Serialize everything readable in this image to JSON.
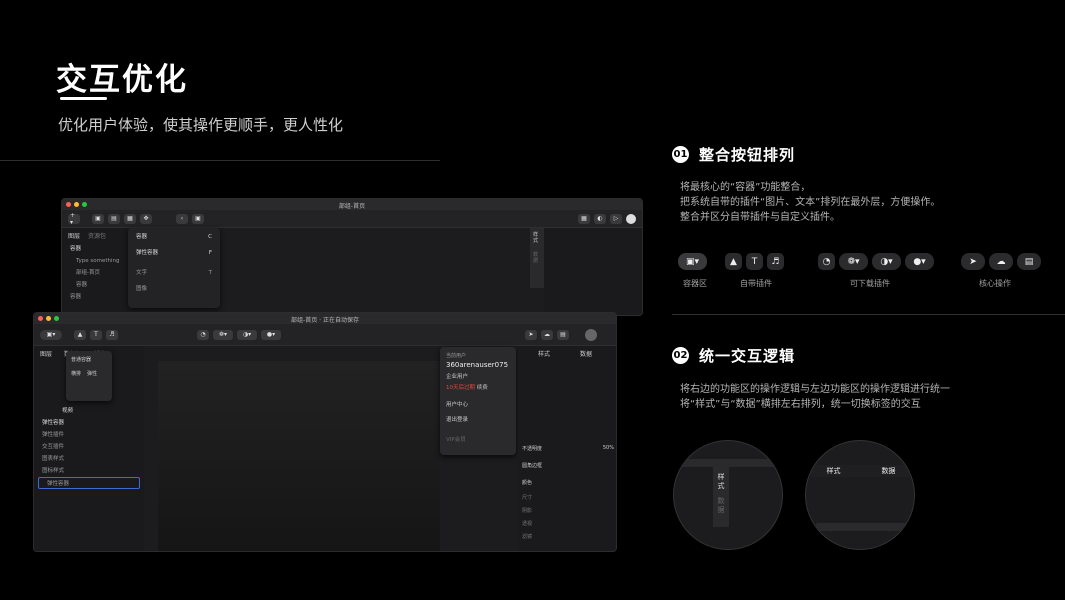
{
  "header": {
    "title": "交互优化",
    "subtitle": "优化用户体验，使其操作更顺手，更人性化"
  },
  "section1": {
    "num": "01",
    "title": "整合按钮排列",
    "desc": [
      "将最核心的“容器”功能整合，",
      "把系统自带的插件“图片、文本”排列在最外层，方便操作。",
      "整合并区分自带插件与自定义插件。"
    ],
    "groups": [
      {
        "label": "容器区"
      },
      {
        "label": "自带插件"
      },
      {
        "label": "可下载插件"
      },
      {
        "label": "核心操作"
      }
    ]
  },
  "section2": {
    "num": "02",
    "title": "统一交互逻辑",
    "desc": [
      "将右边的功能区的操作逻辑与左边功能区的操作逻辑进行统一",
      "将“样式”与“数据”横排左右排列，统一切换标签的交互"
    ]
  },
  "old_window": {
    "title": "部组-首页",
    "tabs": [
      "图层",
      "资源包"
    ],
    "tree": [
      "容器",
      "Type something",
      "部组-首页",
      "容器",
      "容器"
    ],
    "menu": [
      {
        "label": "容器",
        "key": "C"
      },
      {
        "label": "弹性容器",
        "key": "F"
      },
      {
        "label": "文字",
        "key": "T"
      },
      {
        "label": "图像",
        "key": ""
      }
    ],
    "side_tabs": [
      "样式",
      "数据"
    ]
  },
  "new_window": {
    "title": "部组-首页",
    "status": "正在自动保存",
    "tabs": [
      "图层",
      "数据源",
      "插件"
    ],
    "popup_items": [
      "普通容器",
      "横排",
      "弹性"
    ],
    "layers": [
      "视频",
      "弹性容器",
      "弹性插件",
      "交互插件",
      "图表样式",
      "图标样式",
      "弹性容器"
    ],
    "user": {
      "label": "当前用户",
      "name": "360arenauser075",
      "type": "企业用户",
      "expire": "10天后过期",
      "renew": "续费",
      "center": "用户中心",
      "logout": "退出登录",
      "vip": "VIP会员"
    },
    "right_tabs": [
      "样式",
      "数据"
    ],
    "props": [
      "不透明度",
      "圆角边框",
      "颜色",
      "尺寸",
      "阴影",
      "透视",
      "滤镜"
    ],
    "opacity_value": "50%"
  },
  "zoom_old": {
    "tabs": [
      "样",
      "式",
      "数",
      "据"
    ]
  },
  "zoom_new": {
    "tabs": [
      "样式",
      "数据"
    ]
  }
}
